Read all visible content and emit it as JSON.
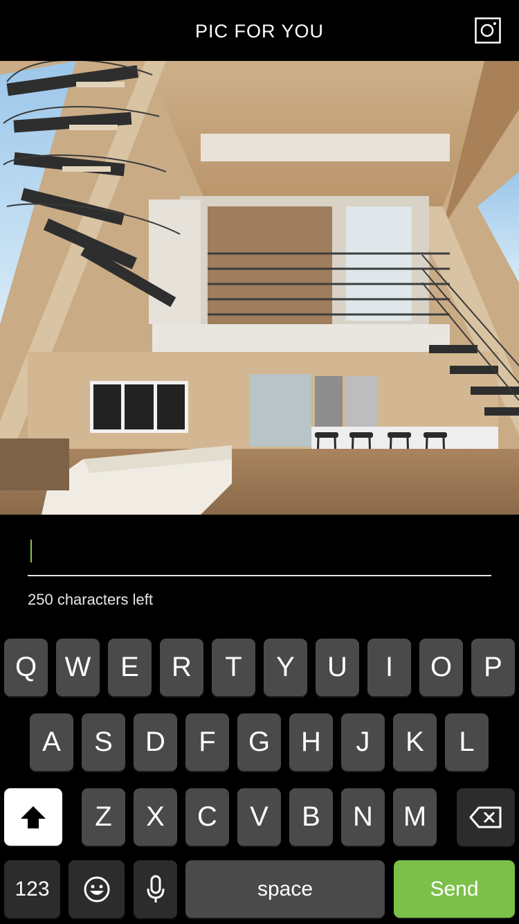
{
  "header": {
    "title": "PIC FOR YOU",
    "action_icon": "instagram-icon"
  },
  "photo": {
    "subject": ""
  },
  "comment": {
    "value": "",
    "counter": "250 characters left"
  },
  "keyboard": {
    "row1": [
      "Q",
      "W",
      "E",
      "R",
      "T",
      "Y",
      "U",
      "I",
      "O",
      "P"
    ],
    "row2": [
      "A",
      "S",
      "D",
      "F",
      "G",
      "H",
      "J",
      "K",
      "L"
    ],
    "row3": [
      "Z",
      "X",
      "C",
      "V",
      "B",
      "N",
      "M"
    ],
    "shift_icon": "shift-icon",
    "backspace_icon": "backspace-icon",
    "numbers_label": "123",
    "emoji_icon": "emoji-icon",
    "mic_icon": "microphone-icon",
    "space_label": "space",
    "send_label": "Send"
  },
  "colors": {
    "accent": "#7cc04a",
    "key": "#4a4a4a",
    "key_dark": "#2c2c2c"
  }
}
